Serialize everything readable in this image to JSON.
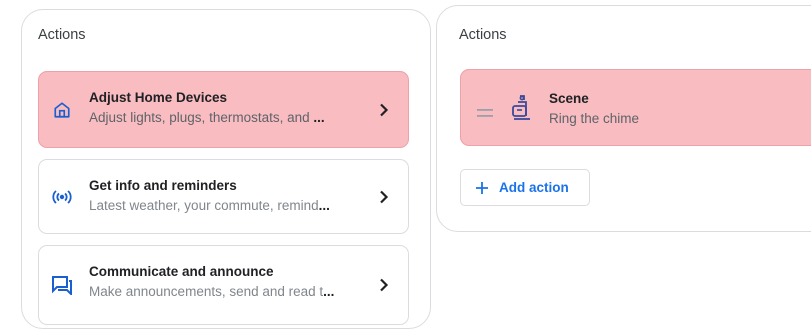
{
  "left_panel": {
    "title": "Actions",
    "cards": [
      {
        "title": "Adjust Home Devices",
        "desc": "Adjust lights, plugs, thermostats, and ",
        "ellipsis": "...",
        "icon": "home-icon",
        "selected": true
      },
      {
        "title": "Get info and reminders",
        "desc": "Latest weather, your commute, remind",
        "ellipsis": "...",
        "icon": "broadcast-icon",
        "selected": false
      },
      {
        "title": "Communicate and announce",
        "desc": "Make announcements, send and read t",
        "ellipsis": "...",
        "icon": "message-icon",
        "selected": false
      }
    ]
  },
  "right_panel": {
    "title": "Actions",
    "scene": {
      "title": "Scene",
      "desc": "Ring the chime",
      "icon": "scene-icon"
    },
    "add_action_label": "Add action"
  },
  "colors": {
    "selected_bg": "#f8bcc1",
    "accent_blue": "#1a73e8",
    "icon_blue": "#1a5fd0",
    "scene_icon": "#3b4a99"
  }
}
